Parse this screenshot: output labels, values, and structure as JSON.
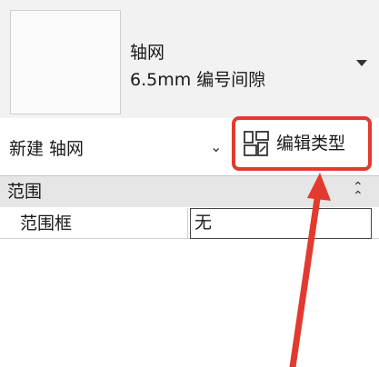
{
  "type_selector": {
    "type_name": "轴网",
    "type_description": "6.5mm 编号间隙"
  },
  "instance_selector": {
    "label": "新建 轴网"
  },
  "edit_type": {
    "label": "编辑类型"
  },
  "group": {
    "title": "范围"
  },
  "parameters": [
    {
      "name": "范围框",
      "value": "无"
    }
  ],
  "colors": {
    "highlight": "#e23a2e",
    "group_header_bg": "#e6e6e6"
  }
}
